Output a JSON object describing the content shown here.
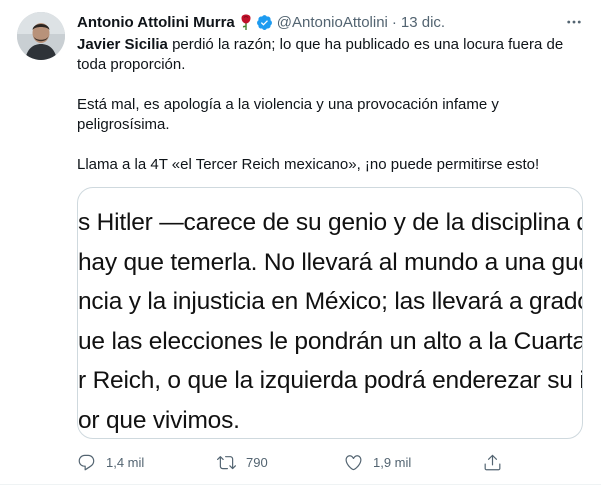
{
  "tweet": {
    "author_name": "Antonio Attolini Murra",
    "handle": "@AntonioAttolini",
    "separator": "·",
    "date": "13 dic.",
    "icons": {
      "rose": "rose-emoji",
      "verified": "verified-badge-icon",
      "more": "more-options-icon"
    },
    "text": {
      "p1_mention": "Javier Sicilia",
      "p1_rest": " perdió la razón; lo que ha publicado es una locura fuera de toda proporción.",
      "p2": "Está mal, es apología a la violencia  y una provocación infame y peligrosísima.",
      "p3": "Llama a la 4T «el Tercer Reich mexicano», ¡no puede permitirse esto!"
    },
    "media_lines": [
      "s Hitler —carece de su genio y de la disciplina de las m",
      "hay que temerla. No llevará al mundo a una guerra",
      "ncia y la injusticia en México; las llevará a grados mu",
      "ue las elecciones le pondrán un alto a la Cuarta Tran",
      "r Reich, o que la izquierda podrá enderezar su intoxi",
      "or que vivimos."
    ],
    "actions": {
      "reply_count": "1,4 mil",
      "retweet_count": "790",
      "like_count": "1,9 mil"
    },
    "colors": {
      "text": "#0f1419",
      "secondary": "#536471",
      "verified": "#1d9bf0",
      "rose": "#c0102a",
      "border": "#cfd9de"
    }
  }
}
